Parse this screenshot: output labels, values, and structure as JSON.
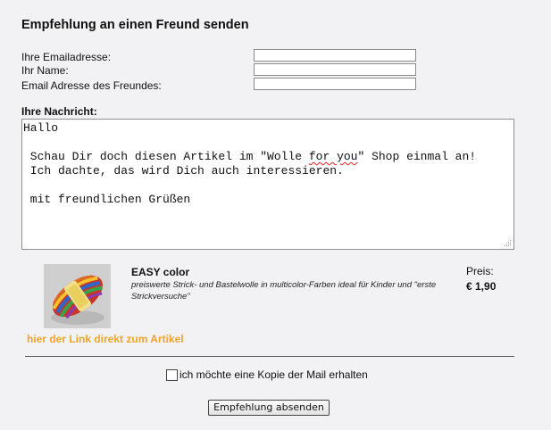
{
  "page": {
    "title": "Empfehlung an einen Freund senden"
  },
  "form": {
    "email_label": "Ihre Emailadresse:",
    "name_label": "Ihr Name:",
    "friend_email_label": "Email Adresse des Freundes:",
    "email_value": "",
    "name_value": "",
    "friend_email_value": "",
    "message_label": "Ihre Nachricht:",
    "message_lines": [
      "Hallo",
      "",
      " Schau Dir doch diesen Artikel im \"Wolle ",
      "for you",
      "\" Shop einmal an!",
      " Ich dachte, das wird Dich auch interessieren.",
      "",
      " mit freundlichen Grüßen"
    ]
  },
  "product": {
    "name": "EASY color",
    "description": "preiswerte Strick- und Bastelwolle in multicolor-Farben ideal für Kinder und \"erste Strickversuche\"",
    "price_label": "Preis:",
    "price_value": "€ 1,90",
    "image_icon": "yarn-ball-image",
    "link_text": "hier der Link direkt zum Artikel"
  },
  "copy": {
    "label": "ich möchte eine Kopie der Mail erhalten",
    "checked": false
  },
  "submit": {
    "label": "Empfehlung absenden"
  },
  "colors": {
    "background": "#f2f1f3",
    "link": "#f0a428"
  }
}
